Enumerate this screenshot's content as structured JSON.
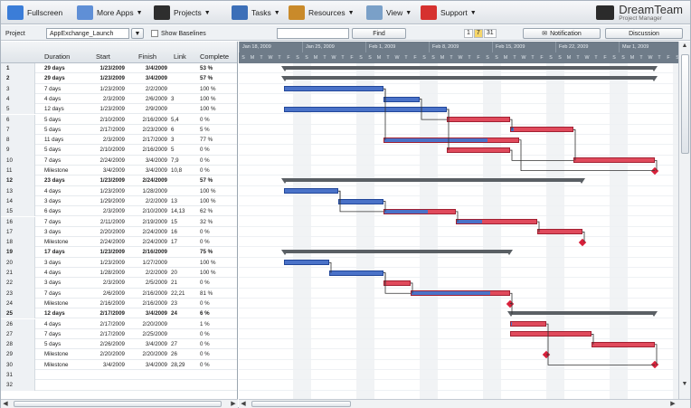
{
  "toolbar": {
    "items": [
      {
        "label": "Fullscreen",
        "icon": "fullscreen-icon",
        "caret": false
      },
      {
        "label": "More Apps",
        "icon": "apps-icon",
        "caret": true
      },
      {
        "label": "Projects",
        "icon": "projects-icon",
        "caret": true
      },
      {
        "label": "Tasks",
        "icon": "tasks-icon",
        "caret": true
      },
      {
        "label": "Resources",
        "icon": "resources-icon",
        "caret": true
      },
      {
        "label": "View",
        "icon": "view-icon",
        "caret": true
      },
      {
        "label": "Support",
        "icon": "support-icon",
        "caret": true
      }
    ],
    "brand_name": "DreamTeam",
    "brand_sub": "Project Manager"
  },
  "projectbar": {
    "project_label": "Project",
    "project_value": "AppExchange_Launch",
    "show_baselines": "Show Baselines",
    "find": "Find",
    "pages": [
      "1",
      "7",
      "31"
    ],
    "notification": "Notification",
    "discussion": "Discussion"
  },
  "grid": {
    "headers": {
      "duration": "Duration",
      "start": "Start",
      "finish": "Finish",
      "link": "Link",
      "complete": "Complete"
    },
    "rows": [
      {
        "n": "1",
        "duration": "29 days",
        "start": "1/23/2009",
        "finish": "3/4/2009",
        "link": "",
        "complete": "53 %",
        "bold": true
      },
      {
        "n": "2",
        "duration": "29 days",
        "start": "1/23/2009",
        "finish": "3/4/2009",
        "link": "",
        "complete": "57 %",
        "bold": true
      },
      {
        "n": "3",
        "duration": "7 days",
        "start": "1/23/2009",
        "finish": "2/2/2009",
        "link": "",
        "complete": "100 %",
        "bold": false
      },
      {
        "n": "4",
        "duration": "4 days",
        "start": "2/3/2009",
        "finish": "2/6/2009",
        "link": "3",
        "complete": "100 %",
        "bold": false
      },
      {
        "n": "5",
        "duration": "12 days",
        "start": "1/23/2009",
        "finish": "2/9/2009",
        "link": "",
        "complete": "100 %",
        "bold": false
      },
      {
        "n": "6",
        "duration": "5 days",
        "start": "2/10/2009",
        "finish": "2/16/2009",
        "link": "5,4",
        "complete": "0 %",
        "bold": false
      },
      {
        "n": "7",
        "duration": "5 days",
        "start": "2/17/2009",
        "finish": "2/23/2009",
        "link": "6",
        "complete": "5 %",
        "bold": false
      },
      {
        "n": "8",
        "duration": "11 days",
        "start": "2/3/2009",
        "finish": "2/17/2009",
        "link": "3",
        "complete": "77 %",
        "bold": false
      },
      {
        "n": "9",
        "duration": "5 days",
        "start": "2/10/2009",
        "finish": "2/16/2009",
        "link": "5",
        "complete": "0 %",
        "bold": false
      },
      {
        "n": "10",
        "duration": "7 days",
        "start": "2/24/2009",
        "finish": "3/4/2009",
        "link": "7,9",
        "complete": "0 %",
        "bold": false
      },
      {
        "n": "11",
        "duration": "Milestone",
        "start": "3/4/2009",
        "finish": "3/4/2009",
        "link": "10,8",
        "complete": "0 %",
        "bold": false
      },
      {
        "n": "12",
        "duration": "23 days",
        "start": "1/23/2009",
        "finish": "2/24/2009",
        "link": "",
        "complete": "57 %",
        "bold": true
      },
      {
        "n": "13",
        "duration": "4 days",
        "start": "1/23/2009",
        "finish": "1/28/2009",
        "link": "",
        "complete": "100 %",
        "bold": false
      },
      {
        "n": "14",
        "duration": "3 days",
        "start": "1/29/2009",
        "finish": "2/2/2009",
        "link": "13",
        "complete": "100 %",
        "bold": false
      },
      {
        "n": "15",
        "duration": "6 days",
        "start": "2/3/2009",
        "finish": "2/10/2009",
        "link": "14,13",
        "complete": "62 %",
        "bold": false
      },
      {
        "n": "16",
        "duration": "7 days",
        "start": "2/11/2009",
        "finish": "2/19/2009",
        "link": "15",
        "complete": "32 %",
        "bold": false
      },
      {
        "n": "17",
        "duration": "3 days",
        "start": "2/20/2009",
        "finish": "2/24/2009",
        "link": "16",
        "complete": "0 %",
        "bold": false
      },
      {
        "n": "18",
        "duration": "Milestone",
        "start": "2/24/2009",
        "finish": "2/24/2009",
        "link": "17",
        "complete": "0 %",
        "bold": false
      },
      {
        "n": "19",
        "duration": "17 days",
        "start": "1/23/2009",
        "finish": "2/16/2009",
        "link": "",
        "complete": "75 %",
        "bold": true
      },
      {
        "n": "20",
        "duration": "3 days",
        "start": "1/23/2009",
        "finish": "1/27/2009",
        "link": "",
        "complete": "100 %",
        "bold": false
      },
      {
        "n": "21",
        "duration": "4 days",
        "start": "1/28/2009",
        "finish": "2/2/2009",
        "link": "20",
        "complete": "100 %",
        "bold": false
      },
      {
        "n": "22",
        "duration": "3 days",
        "start": "2/3/2009",
        "finish": "2/5/2009",
        "link": "21",
        "complete": "0 %",
        "bold": false
      },
      {
        "n": "23",
        "duration": "7 days",
        "start": "2/6/2009",
        "finish": "2/16/2009",
        "link": "22,21",
        "complete": "81 %",
        "bold": false
      },
      {
        "n": "24",
        "duration": "Milestone",
        "start": "2/16/2009",
        "finish": "2/16/2009",
        "link": "23",
        "complete": "0 %",
        "bold": false
      },
      {
        "n": "25",
        "duration": "12 days",
        "start": "2/17/2009",
        "finish": "3/4/2009",
        "link": "24",
        "complete": "6 %",
        "bold": true
      },
      {
        "n": "26",
        "duration": "4 days",
        "start": "2/17/2009",
        "finish": "2/20/2009",
        "link": "",
        "complete": "1 %",
        "bold": false
      },
      {
        "n": "27",
        "duration": "7 days",
        "start": "2/17/2009",
        "finish": "2/25/2009",
        "link": "",
        "complete": "0 %",
        "bold": false
      },
      {
        "n": "28",
        "duration": "5 days",
        "start": "2/26/2009",
        "finish": "3/4/2009",
        "link": "27",
        "complete": "0 %",
        "bold": false
      },
      {
        "n": "29",
        "duration": "Milestone",
        "start": "2/20/2009",
        "finish": "2/20/2009",
        "link": "26",
        "complete": "0 %",
        "bold": false
      },
      {
        "n": "30",
        "duration": "Milestone",
        "start": "3/4/2009",
        "finish": "3/4/2009",
        "link": "28,29",
        "complete": "0 %",
        "bold": false
      },
      {
        "n": "31",
        "duration": "",
        "start": "",
        "finish": "",
        "link": "",
        "complete": "",
        "bold": false
      },
      {
        "n": "32",
        "duration": "",
        "start": "",
        "finish": "",
        "link": "",
        "complete": "",
        "bold": false
      }
    ]
  },
  "chart": {
    "weeks": [
      "Jan 18, 2009",
      "Jan 25, 2009",
      "Feb 1, 2009",
      "Feb 8, 2009",
      "Feb 15, 2009",
      "Feb 22, 2009",
      "Mar 1, 2009"
    ],
    "day_letters": [
      "S",
      "M",
      "T",
      "W",
      "T",
      "F",
      "S"
    ],
    "colors": {
      "task_bar": "#4a72c8",
      "late_bar": "#e04a5c",
      "summary": "#5a5f64",
      "milestone": "#d8203a"
    }
  }
}
